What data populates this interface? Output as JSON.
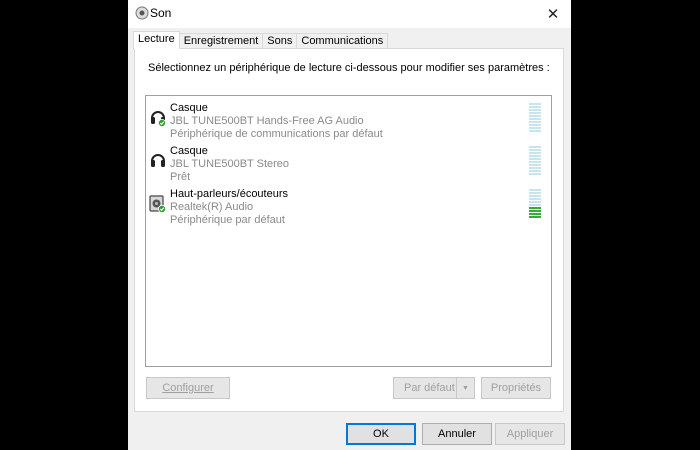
{
  "window": {
    "title": "Son",
    "close_glyph": "✕"
  },
  "tabs": [
    {
      "label": "Lecture",
      "active": true
    },
    {
      "label": "Enregistrement",
      "active": false
    },
    {
      "label": "Sons",
      "active": false
    },
    {
      "label": "Communications",
      "active": false
    }
  ],
  "panel": {
    "instruction": "Sélectionnez un périphérique de lecture ci-dessous pour modifier ses paramètres :"
  },
  "devices": [
    {
      "name": "Casque",
      "description": "JBL TUNE500BT Hands-Free AG Audio",
      "status": "Périphérique de communications par défaut",
      "icon": "headset-icon",
      "default_badge": true,
      "level_active_segments": 0
    },
    {
      "name": "Casque",
      "description": "JBL TUNE500BT Stereo",
      "status": "Prêt",
      "icon": "headset-icon",
      "default_badge": false,
      "level_active_segments": 0
    },
    {
      "name": "Haut-parleurs/écouteurs",
      "description": "Realtek(R) Audio",
      "status": "Périphérique par défaut",
      "icon": "speaker-icon",
      "default_badge": true,
      "level_active_segments": 4
    }
  ],
  "buttons": {
    "configure": "Configurer",
    "set_default": "Par défaut",
    "properties": "Propriétés",
    "ok": "OK",
    "cancel": "Annuler",
    "apply": "Appliquer"
  },
  "colors": {
    "badge_green": "#2e9e2e",
    "meter_idle": "#c8e4ec",
    "meter_active": "#3ca83c",
    "focus_blue": "#0078d7"
  }
}
